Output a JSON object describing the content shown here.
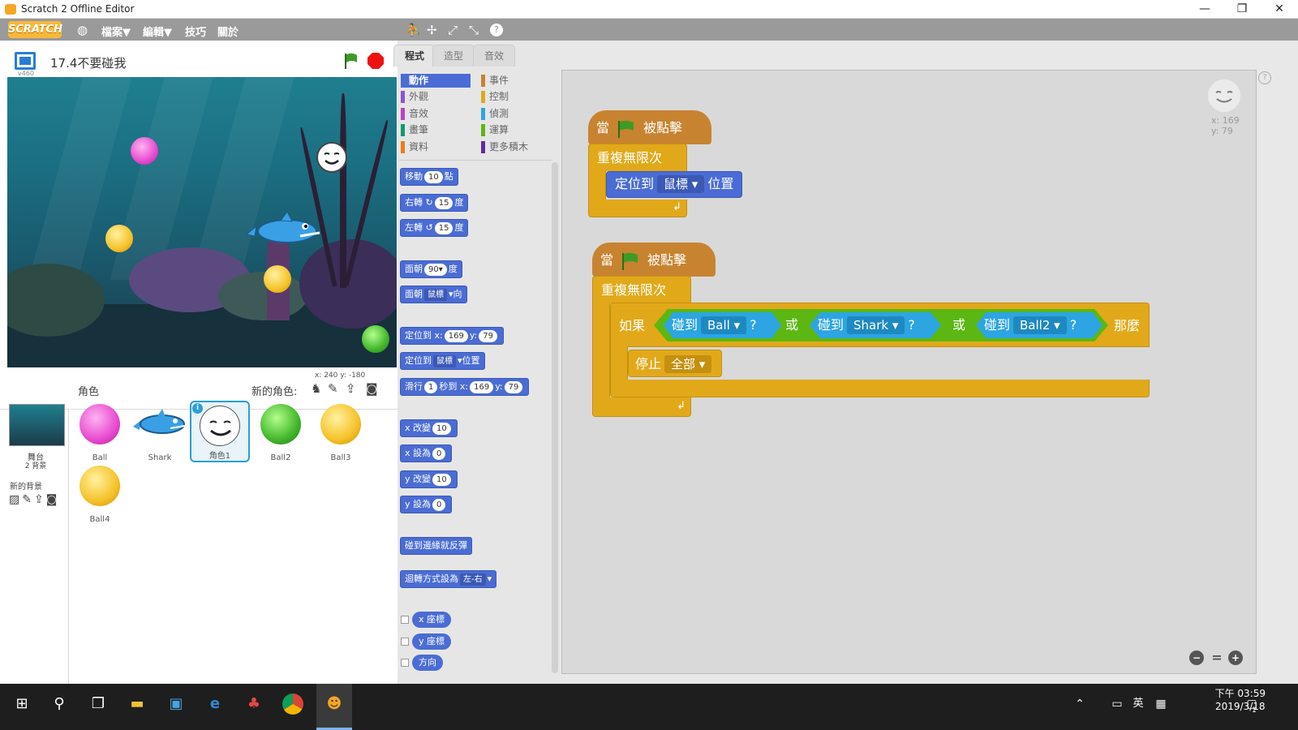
{
  "window": {
    "title": "Scratch 2 Offline Editor",
    "minimize": "—",
    "maximize": "❐",
    "close": "✕"
  },
  "menu": {
    "logo": "SCRATCH",
    "file": "檔案▼",
    "edit": "編輯▼",
    "tips": "技巧",
    "about": "關於"
  },
  "toolbar_icons": [
    "duplicate-icon",
    "cut-icon",
    "grow-icon",
    "shrink-icon",
    "help-icon"
  ],
  "stage": {
    "version": "v460",
    "project_title": "17.4不要碰我",
    "coords": "x: 240  y: -180"
  },
  "sprites_pane": {
    "title": "角色",
    "new_sprite_label": "新的角色:"
  },
  "stage_thumb": {
    "name": "舞台",
    "backdrops": "2 背景",
    "new_backdrop": "新的背景"
  },
  "sprites": [
    {
      "name": "Ball",
      "color": "#e84bd0"
    },
    {
      "name": "Shark",
      "color": "#3aa0e6"
    },
    {
      "name": "角色1",
      "color": "#ffffff",
      "selected": true
    },
    {
      "name": "Ball2",
      "color": "#43b62c"
    },
    {
      "name": "Ball3",
      "color": "#f5c22a"
    },
    {
      "name": "Ball4",
      "color": "#f5c22a"
    }
  ],
  "tabs": {
    "scripts": "程式",
    "costumes": "造型",
    "sounds": "音效"
  },
  "categories": [
    {
      "label": "動作",
      "color": "#4a6cd4",
      "active": true
    },
    {
      "label": "事件",
      "color": "#c88330"
    },
    {
      "label": "外觀",
      "color": "#8a55d7"
    },
    {
      "label": "控制",
      "color": "#e1a91a"
    },
    {
      "label": "音效",
      "color": "#bb42c3"
    },
    {
      "label": "偵測",
      "color": "#2ca5e2"
    },
    {
      "label": "畫筆",
      "color": "#0e9a6c"
    },
    {
      "label": "運算",
      "color": "#5cb712"
    },
    {
      "label": "資料",
      "color": "#ee7d16"
    },
    {
      "label": "更多積木",
      "color": "#632d99"
    }
  ],
  "palette_blocks": {
    "move": "移動",
    "move_n": "10",
    "move_unit": "點",
    "turn_r": "右轉",
    "turn_r_n": "15",
    "deg": "度",
    "turn_l": "左轉",
    "turn_l_n": "15",
    "point_dir": "面朝",
    "point_dir_n": "90▾",
    "point_dir_unit": "度",
    "point_to": "面朝",
    "point_to_dd": "鼠標",
    "point_to_unit": "向",
    "goto_xy": "定位到",
    "x_label": "x:",
    "goto_x": "169",
    "y_label": "y:",
    "goto_y": "79",
    "goto": "定位到",
    "goto_dd": "鼠標",
    "goto_unit": "位置",
    "glide": "滑行",
    "glide_n": "1",
    "glide_mid": "秒到 x:",
    "glide_x": "169",
    "glide_y": "79",
    "change_x": "x 改變",
    "change_x_n": "10",
    "set_x": "x 設為",
    "set_x_n": "0",
    "change_y": "y 改變",
    "change_y_n": "10",
    "set_y": "y 設為",
    "set_y_n": "0",
    "bounce": "碰到邊緣就反彈",
    "rotation": "迴轉方式設為",
    "rotation_dd": "左-右",
    "rep_x": "x 座標",
    "rep_y": "y 座標",
    "rep_dir": "方向"
  },
  "scripts": {
    "s1_when": "當",
    "s1_clicked": "被點擊",
    "s1_forever": "重複無限次",
    "s1_goto": "定位到",
    "s1_goto_dd": "鼠標",
    "s1_goto_unit": "位置",
    "s2_when": "當",
    "s2_clicked": "被點擊",
    "s2_forever": "重複無限次",
    "if": "如果",
    "touch": "碰到",
    "t1": "Ball",
    "t2": "Shark",
    "t3": "Ball2",
    "q": "?",
    "or": "或",
    "then": "那麼",
    "stop": "停止",
    "stop_dd": "全部"
  },
  "sprite_info": {
    "x": "x: 169",
    "y": "y: 79"
  },
  "zoom": {
    "out": "−",
    "reset": "=",
    "in": "+"
  },
  "taskbar": {
    "time": "下午 03:59",
    "date": "2019/3/18",
    "ime": "英",
    "notif": "1"
  }
}
